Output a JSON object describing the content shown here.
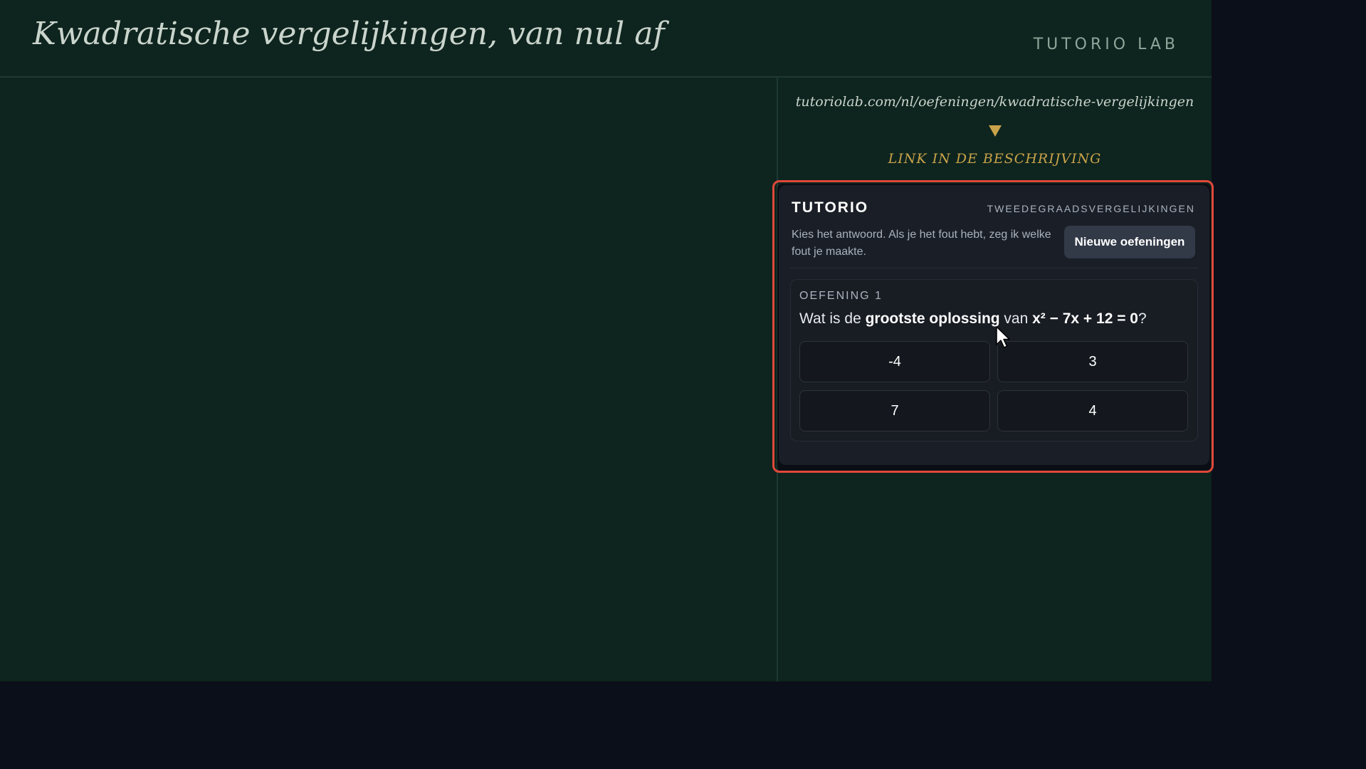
{
  "header": {
    "title": "Kwadratische vergelijkingen, van nul af",
    "brand": "TUTORIO LAB"
  },
  "promo": {
    "url": "tutoriolab.com/nl/oefeningen/kwadratische-vergelijkingen",
    "cta": "LINK IN DE BESCHRIJVING",
    "arrow_icon": "triangle-down-icon"
  },
  "widget": {
    "brand": "TUTORIO",
    "topic": "TWEEDEGRAADSVERGELIJKINGEN",
    "instructions": "Kies het antwoord. Als je het fout hebt, zeg ik welke fout je maakte.",
    "new_button_label": "Nieuwe oefeningen",
    "exercise": {
      "label": "OEFENING 1",
      "question_prefix": "Wat is de ",
      "question_emphasis": "grootste oplossing",
      "question_middle": " van ",
      "question_equation_lhs": "x² − 7x + 12 = 0",
      "question_suffix": "?",
      "options": [
        "-4",
        "3",
        "7",
        "4"
      ]
    }
  },
  "colors": {
    "stage_bg": "#0e241e",
    "page_bg": "#0b0f1a",
    "accent_gold": "#c9a34a",
    "highlight_red": "#e0483a",
    "widget_bg": "#1a1f27"
  }
}
